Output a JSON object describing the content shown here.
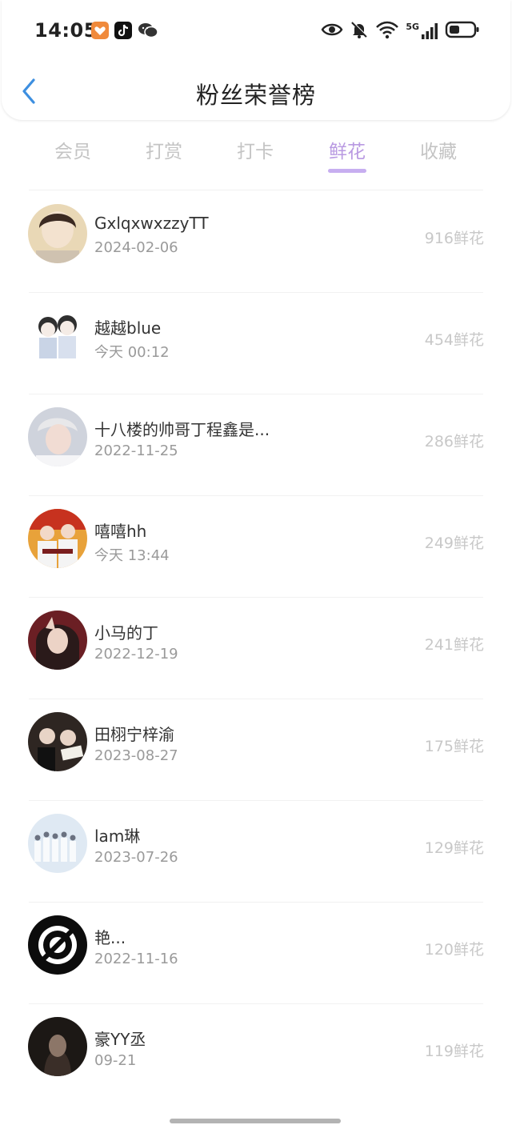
{
  "status_bar": {
    "time": "14:05",
    "network": "5G",
    "icons": [
      "app-badge-icon",
      "tiktok-icon",
      "wechat-icon",
      "eye-icon",
      "mute-bell-icon",
      "wifi-icon",
      "signal-icon",
      "battery-icon"
    ]
  },
  "header": {
    "title": "粉丝荣誉榜",
    "back_icon": "chevron-left-icon"
  },
  "tabs": [
    {
      "label": "会员",
      "active": false
    },
    {
      "label": "打赏",
      "active": false
    },
    {
      "label": "打卡",
      "active": false
    },
    {
      "label": "鲜花",
      "active": true
    },
    {
      "label": "收藏",
      "active": false
    }
  ],
  "fans": [
    {
      "name": "GxlqxwxzzyTT",
      "date": "2024-02-06",
      "count": "916鲜花"
    },
    {
      "name": "越越blue",
      "date": "今天 00:12",
      "count": "454鲜花"
    },
    {
      "name": "十八楼的帅哥丁程鑫是...",
      "date": "2022-11-25",
      "count": "286鲜花"
    },
    {
      "name": "嘻嘻hh",
      "date": "今天 13:44",
      "count": "249鲜花"
    },
    {
      "name": "小马的丁",
      "date": "2022-12-19",
      "count": "241鲜花"
    },
    {
      "name": "田栩宁梓渝",
      "date": "2023-08-27",
      "count": "175鲜花"
    },
    {
      "name": "lam琳",
      "date": "2023-07-26",
      "count": "129鲜花"
    },
    {
      "name": "艳...",
      "date": "2022-11-16",
      "count": "120鲜花"
    },
    {
      "name": "豪YY丞",
      "date": "09-21",
      "count": "119鲜花"
    }
  ],
  "colors": {
    "accent": "#b99ae2",
    "tab_inactive": "#c4c4c4",
    "back_arrow": "#3d8fe0",
    "count_text": "#c8c8c8"
  }
}
